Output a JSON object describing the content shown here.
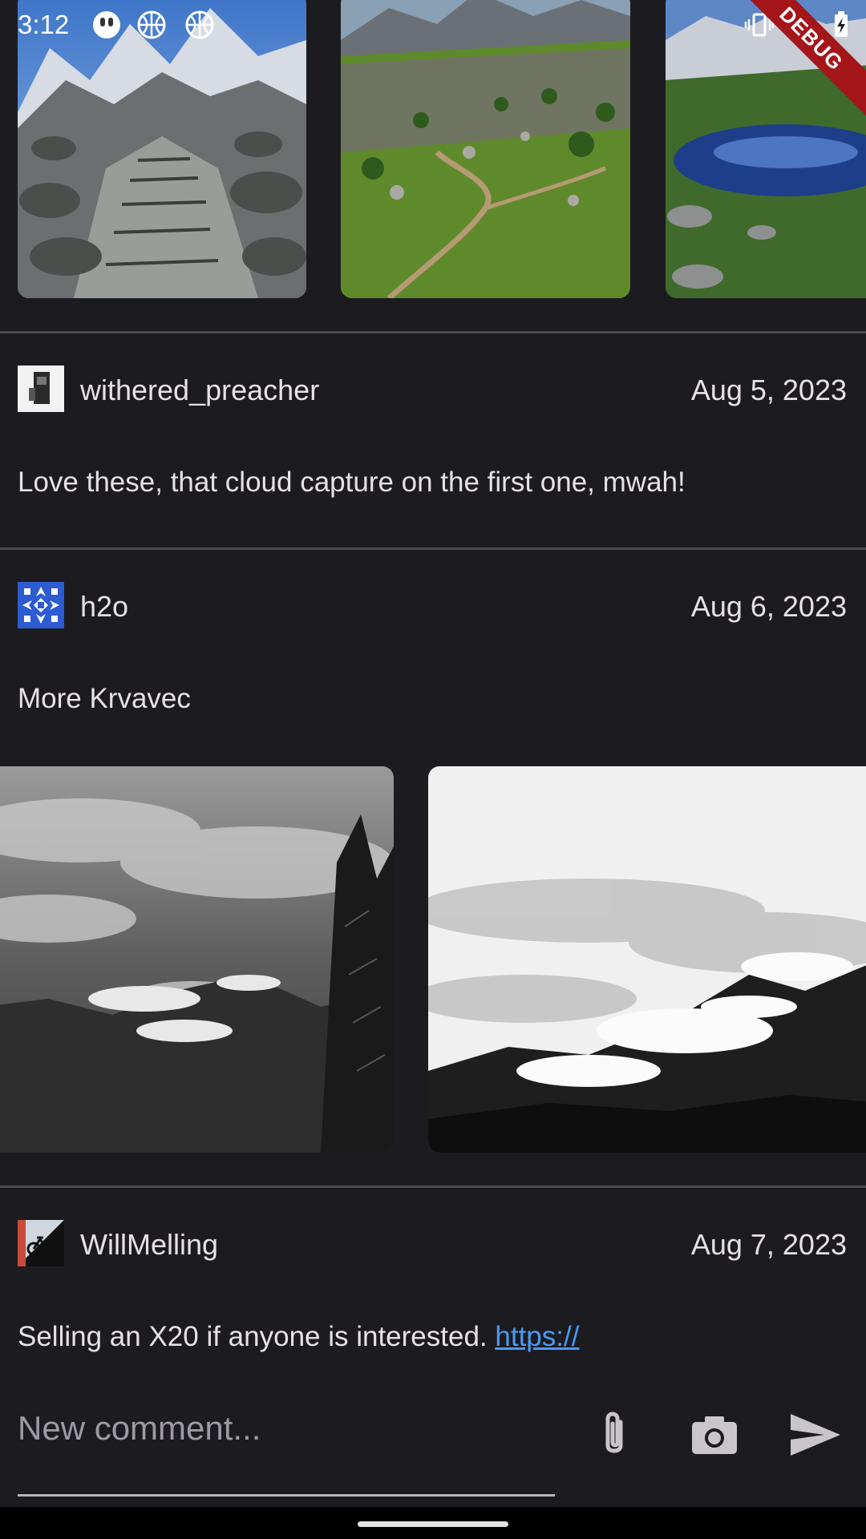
{
  "status_bar": {
    "time": "3:12",
    "left_icons": [
      "app-notification-icon",
      "basketball-icon",
      "basketball-icon"
    ],
    "right_icons": [
      "vibrate-icon",
      "wifi-icon",
      "battery-charging-icon"
    ],
    "debug_label": "DEBUG"
  },
  "gallery_top": {
    "photos": [
      "mountain-stone-steps-photo",
      "green-valley-trail-photo",
      "alpine-lake-reflection-photo"
    ]
  },
  "comments": [
    {
      "username": "withered_preacher",
      "date": "Aug 5, 2023",
      "text": "Love these, that cloud capture on the first one, mwah!"
    },
    {
      "username": "h2o",
      "date": "Aug 6, 2023",
      "text": "More Krvavec"
    },
    {
      "username": "WillMelling",
      "date": "Aug 7, 2023",
      "text": "Selling an X20 if anyone is interested. ",
      "link": "https://"
    }
  ],
  "gallery_h2o": {
    "photos": [
      "bw-cloudy-mountains-photo",
      "bw-misty-peaks-photo"
    ]
  },
  "composer": {
    "placeholder": "New comment...",
    "attach_icon": "paperclip-icon",
    "camera_icon": "camera-icon",
    "send_icon": "send-icon"
  },
  "colors": {
    "background": "#1c1b20",
    "text": "#e6e1e5",
    "link": "#4a9af0",
    "divider": "#4a4950",
    "debug_ribbon": "#a4161a"
  }
}
